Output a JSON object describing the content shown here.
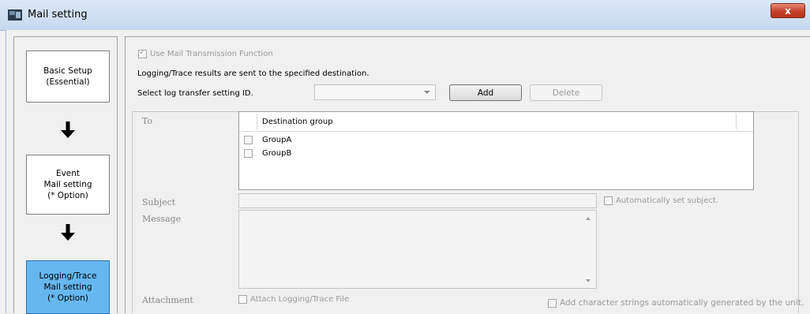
{
  "window": {
    "title": "Mail setting",
    "close_glyph": "x"
  },
  "nav": {
    "items": [
      {
        "label": "Basic Setup\n(Essential)",
        "active": false
      },
      {
        "label": "Event\nMail setting\n(* Option)",
        "active": false
      },
      {
        "label": "Logging/Trace\nMail setting\n(* Option)",
        "active": true
      }
    ],
    "arrow_icon": "down-arrow-icon"
  },
  "main": {
    "use_mail_label": "Use Mail Transmission Function",
    "use_mail_checked": true,
    "description": "Logging/Trace results are sent to the specified destination.",
    "select_id_label": "Select log transfer setting ID.",
    "select_id_value": "",
    "add_label": "Add",
    "delete_label": "Delete",
    "to_label": "To",
    "table": {
      "header": "Destination group",
      "rows": [
        {
          "label": "GroupA",
          "checked": false
        },
        {
          "label": "GroupB",
          "checked": false
        }
      ]
    },
    "subject_label": "Subject",
    "subject_value": "",
    "auto_subject_label": "Automatically set subject.",
    "message_label": "Message",
    "message_value": "",
    "attachment_label": "Attachment",
    "attach_file_label": "Attach Logging/Trace File",
    "auto_string_label": "Add character strings automatically generated by the unit."
  },
  "colors": {
    "active_nav": "#66b7f0",
    "close_button": "#c7402b"
  }
}
